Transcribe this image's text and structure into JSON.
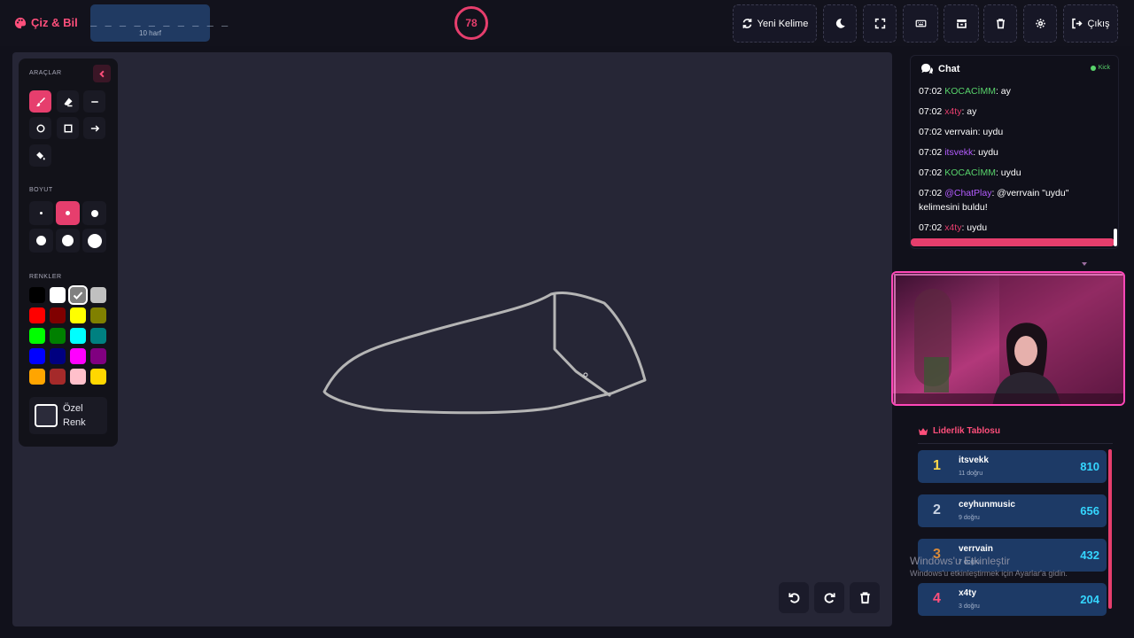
{
  "header": {
    "brand": "Çiz & Bil",
    "word_dashes": "_ _ _ _ _ _ _ _ _ _",
    "word_hint": "10 harf",
    "timer": "78",
    "buttons": {
      "new_word": "Yeni Kelime",
      "exit": "Çıkış"
    }
  },
  "tools": {
    "tools_label": "ARAÇLAR",
    "size_label": "BOYUT",
    "colors_label": "RENKLER",
    "custom_color_label": "Özel Renk",
    "active_tool": "brush",
    "active_size": 2,
    "colors": [
      "#000000",
      "#ffffff",
      "#808080",
      "#c0c0c0",
      "#ff0000",
      "#800000",
      "#ffff00",
      "#808000",
      "#00ff00",
      "#008000",
      "#00ffff",
      "#008080",
      "#0000ff",
      "#000080",
      "#ff00ff",
      "#800080",
      "#ffa500",
      "#a52a2a",
      "#ffc0cb",
      "#ffd700"
    ],
    "selected_color": "#808080"
  },
  "chat": {
    "title": "Chat",
    "platform": "Kick",
    "messages": [
      {
        "time": "07:02",
        "user": "KOCACİMM",
        "user_color": "#58d36b",
        "text": ": ay"
      },
      {
        "time": "07:02",
        "user": "x4ty",
        "user_color": "#e63e6d",
        "text": ": ay"
      },
      {
        "time": "07:02",
        "user": "verrvain",
        "user_color": "#ffffff",
        "text": ": uydu"
      },
      {
        "time": "07:02",
        "user": "itsvekk",
        "user_color": "#b45cff",
        "text": ": uydu"
      },
      {
        "time": "07:02",
        "user": "KOCACİMM",
        "user_color": "#58d36b",
        "text": ": uydu"
      },
      {
        "time": "07:02",
        "user": "@ChatPlay",
        "user_color": "#b45cff",
        "text": ": @verrvain \"uydu\" kelimesini buldu!"
      },
      {
        "time": "07:02",
        "user": "x4ty",
        "user_color": "#e63e6d",
        "text": ": uydu"
      }
    ]
  },
  "leaderboard": {
    "title": "Liderlik Tablosu",
    "rows": [
      {
        "rank": "1",
        "name": "itsvekk",
        "sub": "11 doğru",
        "score": "810",
        "rank_color": "#ffd84a"
      },
      {
        "rank": "2",
        "name": "ceyhunmusic",
        "sub": "9 doğru",
        "score": "656",
        "rank_color": "#c9d3e3"
      },
      {
        "rank": "3",
        "name": "verrvain",
        "sub": "7 doğru",
        "score": "432",
        "rank_color": "#d98a3a"
      },
      {
        "rank": "4",
        "name": "x4ty",
        "sub": "3 doğru",
        "score": "204",
        "rank_color": "#ff4f7b"
      }
    ]
  },
  "watermark": {
    "title": "Windows'u Etkinleştir",
    "subtitle": "Windows'u etkinleştirmek için Ayarlar'a gidin."
  },
  "colors": {
    "accent": "#e63e6d",
    "canvas": "#262636",
    "panel": "#121219",
    "score": "#35d6ff",
    "row": "#1d3a66"
  }
}
